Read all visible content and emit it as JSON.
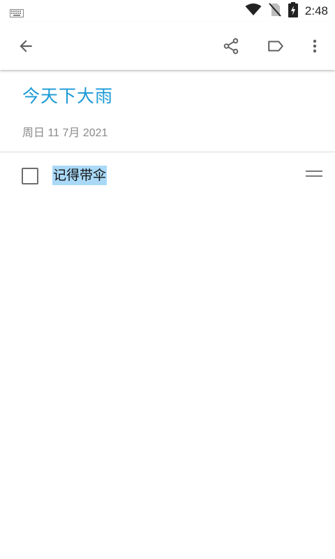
{
  "status_bar": {
    "time": "2:48",
    "icons": [
      "keyboard-icon",
      "wifi-icon",
      "no-sim-icon",
      "battery-charging-icon"
    ]
  },
  "toolbar": {
    "icons": [
      "back-arrow-icon",
      "share-icon",
      "label-icon",
      "more-vert-icon"
    ]
  },
  "note": {
    "title": "今天下大雨",
    "date": "周日 11 7月 2021",
    "checklist": [
      {
        "text": "记得带伞",
        "checked": false
      }
    ]
  },
  "colors": {
    "title": "#1a9ad6",
    "date": "#8a8a8a",
    "selection_highlight": "#a9d9f7",
    "icon": "#6e6e6e"
  }
}
